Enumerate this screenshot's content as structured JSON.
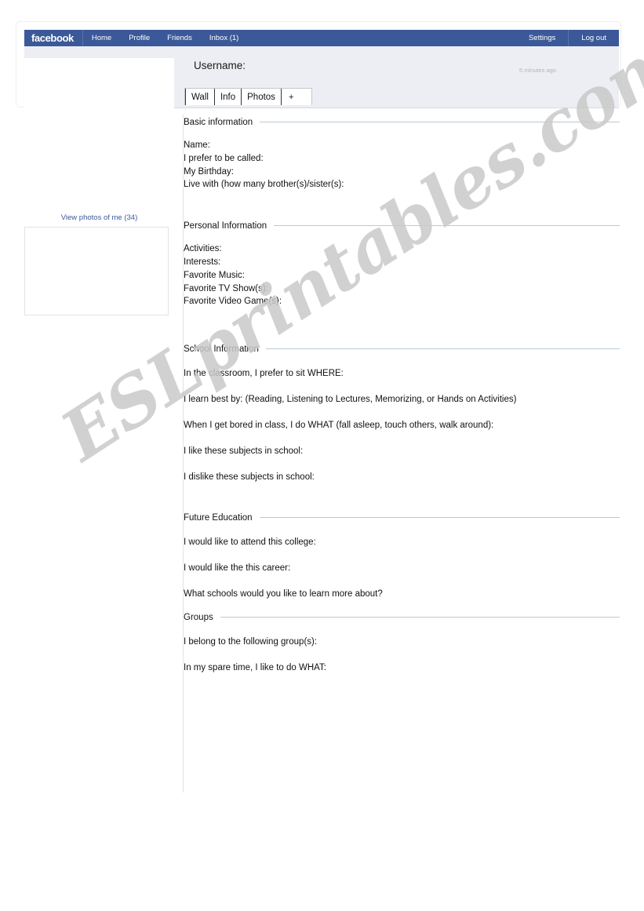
{
  "header": {
    "logo": "facebook",
    "nav_left": [
      {
        "label": "Home"
      },
      {
        "label": "Profile"
      },
      {
        "label": "Friends"
      },
      {
        "label": "Inbox (1)"
      }
    ],
    "nav_right": [
      {
        "label": "Settings"
      },
      {
        "label": "Log out"
      }
    ]
  },
  "profile": {
    "username_label": "Username:",
    "timestamp": "5 minutes ago",
    "tabs": [
      {
        "label": "Wall"
      },
      {
        "label": "Info"
      },
      {
        "label": "Photos"
      },
      {
        "label": "+"
      }
    ]
  },
  "sidebar": {
    "view_photos_link": "View photos of me (34)"
  },
  "sections": {
    "basic": {
      "title": "Basic information",
      "fields": [
        "Name:",
        "I prefer to be called:",
        "My Birthday:",
        "Live with (how many brother(s)/sister(s):"
      ]
    },
    "personal": {
      "title": "Personal Information",
      "fields": [
        "Activities:",
        "Interests:",
        "Favorite Music:",
        "Favorite TV Show(s):",
        "Favorite Video Game(s):"
      ]
    },
    "school": {
      "title": "School Information",
      "fields": [
        "In the classroom, I prefer to sit WHERE:",
        "I learn best by: (Reading, Listening to Lectures, Memorizing, or Hands on Activities)",
        "When I get bored in class, I do WHAT (fall asleep, touch others, walk around):",
        "I like these subjects in school:",
        "I dislike these subjects in school:"
      ]
    },
    "future": {
      "title": "Future Education",
      "fields": [
        "I would like to attend this college:",
        "I would like the this career:",
        " What schools would you like to learn more about?"
      ]
    },
    "groups": {
      "title": "Groups",
      "fields": [
        "I belong to the following group(s):",
        "In my spare time, I like to do WHAT:"
      ]
    }
  },
  "watermark": {
    "text": "ESLprintables.com"
  },
  "colors": {
    "brand_blue": "#3b5998",
    "panel_grey": "#eceef3",
    "rule_blue": "#b8cbd8",
    "link_blue": "#3b5998",
    "timestamp_grey": "#b4b4b4"
  }
}
